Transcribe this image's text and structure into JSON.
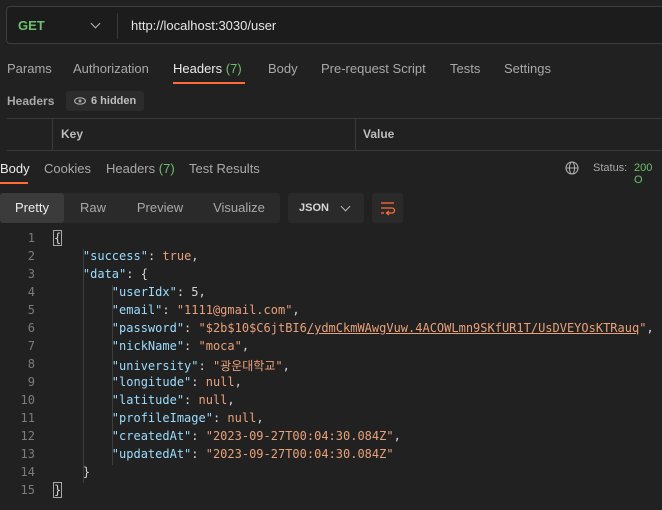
{
  "request": {
    "method": "GET",
    "url": "http://localhost:3030/user"
  },
  "request_tabs": [
    {
      "label": "Params"
    },
    {
      "label": "Authorization"
    },
    {
      "label": "Headers",
      "count": "(7)"
    },
    {
      "label": "Body"
    },
    {
      "label": "Pre-request Script"
    },
    {
      "label": "Tests"
    },
    {
      "label": "Settings"
    }
  ],
  "headers_section": {
    "label": "Headers",
    "hidden_text": "6 hidden",
    "col_key": "Key",
    "col_value": "Value"
  },
  "response_tabs": [
    {
      "label": "Body"
    },
    {
      "label": "Cookies"
    },
    {
      "label": "Headers",
      "count": "(7)"
    },
    {
      "label": "Test Results"
    }
  ],
  "status": {
    "label": "Status:",
    "value": "200 O"
  },
  "view_modes": [
    "Pretty",
    "Raw",
    "Preview",
    "Visualize"
  ],
  "format": "JSON",
  "colors": {
    "accent": "#ff6c37",
    "method_green": "#6cc070",
    "json_key": "#9cdcfe",
    "json_string": "#e9a17a"
  },
  "code_lines": [
    {
      "n": "1",
      "text": "{"
    },
    {
      "n": "2",
      "key": "\"success\"",
      "val": "true",
      "tail": ","
    },
    {
      "n": "3",
      "key": "\"data\"",
      "val": "{",
      "tail": ""
    },
    {
      "n": "4",
      "key": "\"userIdx\"",
      "val": "5",
      "tail": ","
    },
    {
      "n": "5",
      "key": "\"email\"",
      "val": "\"1111@gmail.com\"",
      "tail": ","
    },
    {
      "n": "6",
      "key": "\"password\"",
      "val_a": "\"$2b$10$C6jtBI6",
      "val_b": "/ydmCkmWAwgVuw.4ACOWLmn9SKfUR1T/UsDVEYOsKTRauq",
      "val_c": "\"",
      "tail": ","
    },
    {
      "n": "7",
      "key": "\"nickName\"",
      "val": "\"moca\"",
      "tail": ","
    },
    {
      "n": "8",
      "key": "\"university\"",
      "val": "\"광운대학교\"",
      "tail": ","
    },
    {
      "n": "9",
      "key": "\"longitude\"",
      "val": "null",
      "tail": ","
    },
    {
      "n": "10",
      "key": "\"latitude\"",
      "val": "null",
      "tail": ","
    },
    {
      "n": "11",
      "key": "\"profileImage\"",
      "val": "null",
      "tail": ","
    },
    {
      "n": "12",
      "key": "\"createdAt\"",
      "val": "\"2023-09-27T00:04:30.084Z\"",
      "tail": ","
    },
    {
      "n": "13",
      "key": "\"updatedAt\"",
      "val": "\"2023-09-27T00:04:30.084Z\"",
      "tail": ""
    },
    {
      "n": "14",
      "text": "}"
    },
    {
      "n": "15",
      "text": "}"
    }
  ]
}
